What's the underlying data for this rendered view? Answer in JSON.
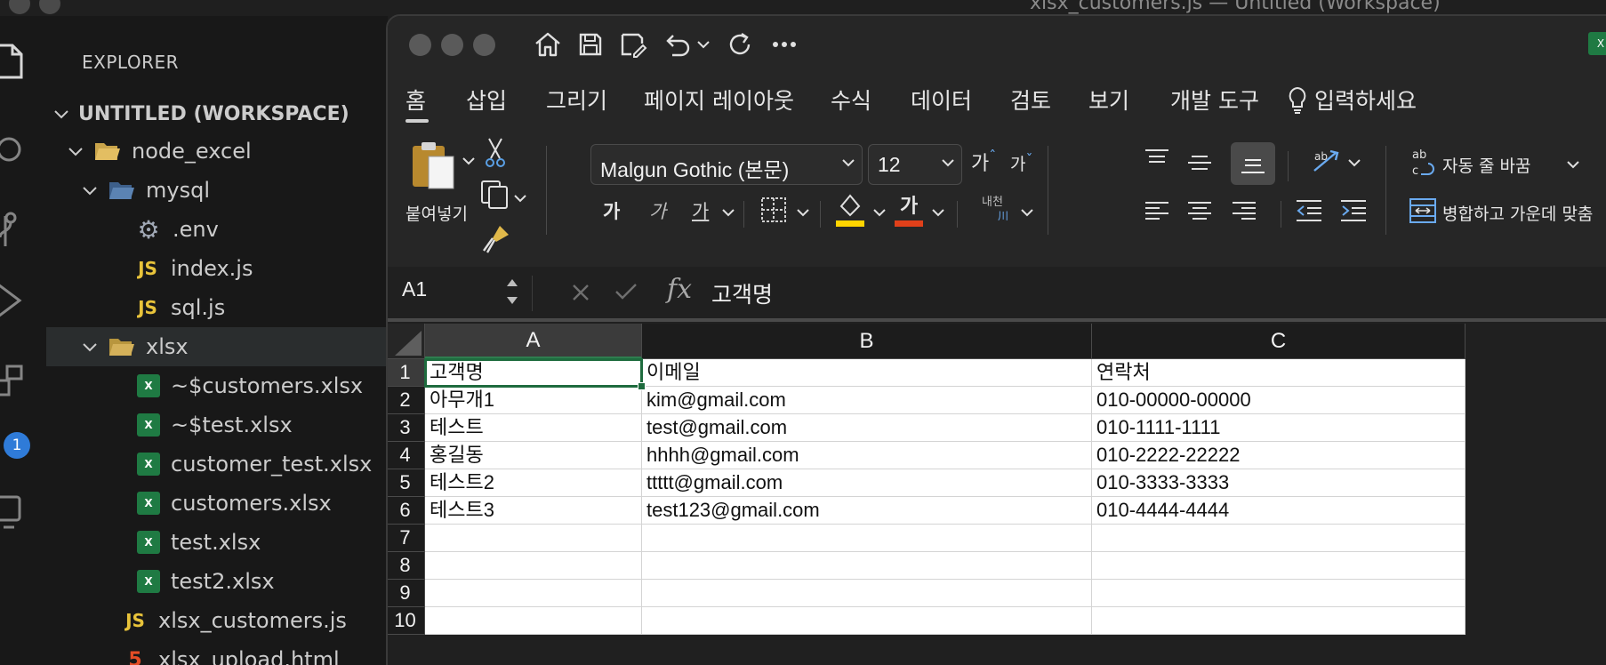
{
  "vscode": {
    "window_title": "xlsx_customers.js — Untitled (Workspace)",
    "explorer_title": "EXPLORER",
    "workspace": "UNTITLED (WORKSPACE)",
    "badge_count": "1",
    "tree": [
      {
        "label": "node_excel",
        "type": "folder-open",
        "chevron": "down"
      },
      {
        "label": "mysql",
        "type": "folder-open",
        "chevron": "down"
      },
      {
        "label": ".env",
        "type": "gear"
      },
      {
        "label": "index.js",
        "type": "js"
      },
      {
        "label": "sql.js",
        "type": "js"
      },
      {
        "label": "xlsx",
        "type": "folder-open",
        "chevron": "down"
      },
      {
        "label": "~$customers.xlsx",
        "type": "xlsx"
      },
      {
        "label": "~$test.xlsx",
        "type": "xlsx"
      },
      {
        "label": "customer_test.xlsx",
        "type": "xlsx"
      },
      {
        "label": "customers.xlsx",
        "type": "xlsx"
      },
      {
        "label": "test.xlsx",
        "type": "xlsx"
      },
      {
        "label": "test2.xlsx",
        "type": "xlsx"
      },
      {
        "label": "xlsx_customers.js",
        "type": "js"
      },
      {
        "label": "xlsx_upload.html",
        "type": "html"
      }
    ],
    "icon_labels": {
      "js": "JS",
      "html": "5",
      "xlsx": "X"
    }
  },
  "excel": {
    "logo_text": "X",
    "tabs": [
      "홈",
      "삽입",
      "그리기",
      "페이지 레이아웃",
      "수식",
      "데이터",
      "검토",
      "보기",
      "개발 도구"
    ],
    "tell_me": "입력하세요",
    "ribbon": {
      "paste_label": "붙여넣기",
      "font_name": "Malgun Gothic (본문)",
      "font_size": "12",
      "grow_font": "가",
      "shrink_font": "가",
      "bold": "가",
      "italic": "가",
      "underline": "가",
      "font_color_glyph": "가",
      "phonetic_top": "내천",
      "phonetic_bottom": "川",
      "wrap_text": "자동 줄 바꿈",
      "merge_center": "병합하고 가운데 맞춤",
      "orientation_glyph": "ab",
      "wrap_glyph": "ab",
      "accent_colors": {
        "fill": "#ffd400",
        "font": "#e0401a",
        "excel_green": "#1e6b3e"
      }
    },
    "name_box": "A1",
    "formula_value": "고객명",
    "columns": [
      "A",
      "B",
      "C"
    ],
    "rows": [
      "1",
      "2",
      "3",
      "4",
      "5",
      "6",
      "7",
      "8",
      "9",
      "10"
    ],
    "cells": [
      [
        "고객명",
        "이메일",
        "연락처"
      ],
      [
        "아무개1",
        "kim@gmail.com",
        "010-00000-00000"
      ],
      [
        "테스트",
        "test@gmail.com",
        "010-1111-1111"
      ],
      [
        "홍길동",
        "hhhh@gmail.com",
        "010-2222-22222"
      ],
      [
        "테스트2",
        "ttttt@gmail.com",
        "010-3333-3333"
      ],
      [
        "테스트3",
        "test123@gmail.com",
        "010-4444-4444"
      ],
      [
        "",
        "",
        ""
      ],
      [
        "",
        "",
        ""
      ],
      [
        "",
        "",
        ""
      ],
      [
        "",
        "",
        ""
      ]
    ]
  }
}
